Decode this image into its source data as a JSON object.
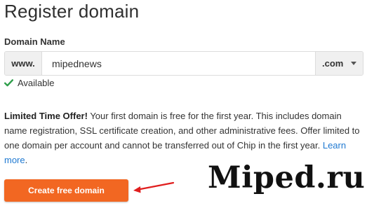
{
  "page": {
    "title": "Register domain"
  },
  "domain": {
    "label": "Domain Name",
    "prefix": "www.",
    "name_value": "mipednews",
    "tld_selected": ".com",
    "availability": "Available"
  },
  "offer": {
    "heading": "Limited Time Offer!",
    "text": " Your first domain is free for the first year. This includes domain name registration, SSL certificate creation, and other administrative fees. Offer limited to one domain per account and cannot be transferred out of Chip in the first year. ",
    "learn_more": "Learn more",
    "suffix": "."
  },
  "actions": {
    "create_label": "Create free domain"
  },
  "watermark": {
    "text": "Miped.ru"
  },
  "colors": {
    "accent": "#f26722",
    "link": "#1f79d1",
    "success": "#2e9e4a",
    "annotation": "#e01e1e"
  },
  "icons": {
    "available": "check-icon",
    "tld_caret": "chevron-down-icon",
    "annotation": "arrow-icon"
  }
}
